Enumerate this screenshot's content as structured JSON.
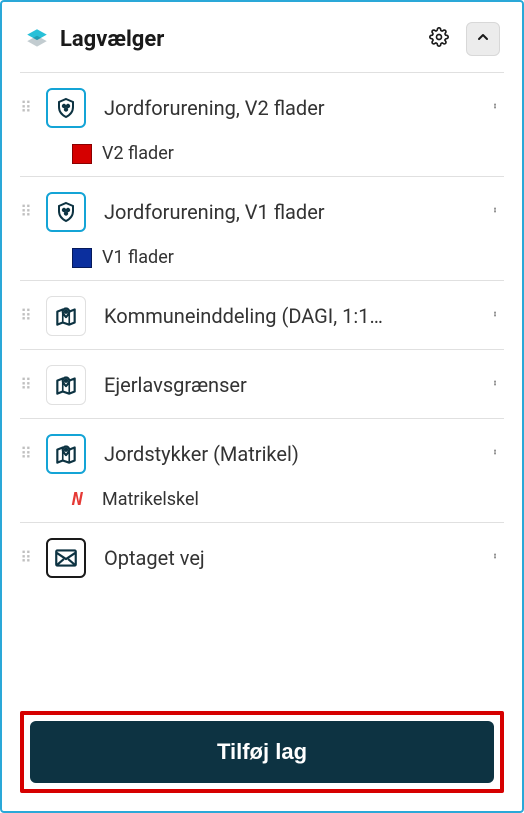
{
  "header": {
    "title": "Lagvælger",
    "settings_icon": "gear",
    "collapse_icon": "chevron-up"
  },
  "layers": [
    {
      "id": "jord-v2",
      "label": "Jordforurening, V2 flader",
      "icon": "shield",
      "active": true,
      "legend": {
        "kind": "swatch",
        "color": "red",
        "label": "V2 flader"
      }
    },
    {
      "id": "jord-v1",
      "label": "Jordforurening, V1 flader",
      "icon": "shield",
      "active": true,
      "legend": {
        "kind": "swatch",
        "color": "blue",
        "label": "V1 flader"
      }
    },
    {
      "id": "kommune",
      "label": "Kommuneinddeling (DAGI, 1:1…",
      "icon": "map-pin",
      "active": false
    },
    {
      "id": "ejerlav",
      "label": "Ejerlavsgrænser",
      "icon": "map-pin",
      "active": false
    },
    {
      "id": "jordstykker",
      "label": "Jordstykker (Matrikel)",
      "icon": "map-pin",
      "active": true,
      "legend": {
        "kind": "nv",
        "label": "Matrikelskel"
      }
    },
    {
      "id": "optaget-vej",
      "label": "Optaget vej",
      "icon": "envelope",
      "active": false,
      "outline": true
    }
  ],
  "footer": {
    "add_label": "Tilføj lag"
  }
}
